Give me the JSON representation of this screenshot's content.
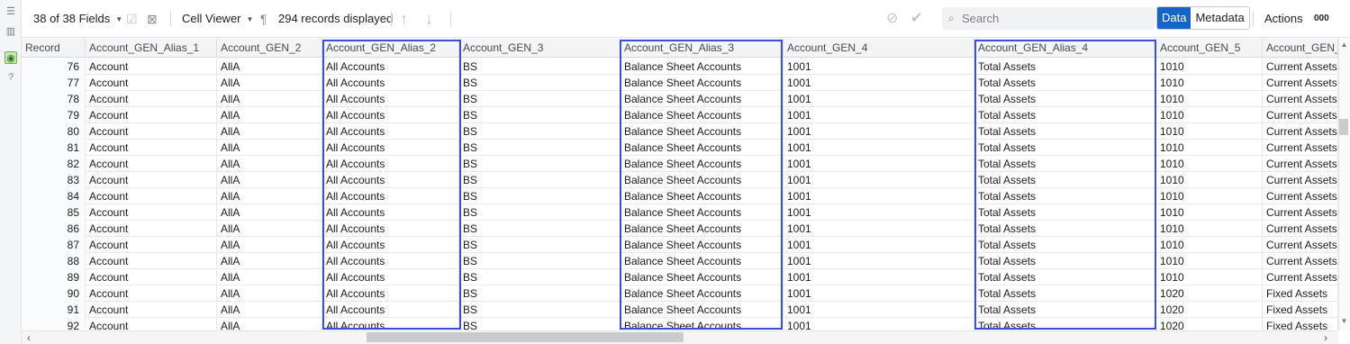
{
  "toolbar": {
    "fields_label": "38 of 38 Fields",
    "cell_viewer_label": "Cell Viewer",
    "pilcrow": "¶",
    "records_label": "294 records displayed",
    "search_placeholder": "Search",
    "data_label": "Data",
    "metadata_label": "Metadata",
    "actions_label": "Actions",
    "more_label": "000"
  },
  "columns": [
    "Record",
    "Account_GEN_Alias_1",
    "Account_GEN_2",
    "Account_GEN_Alias_2",
    "Account_GEN_3",
    "Account_GEN_Alias_3",
    "Account_GEN_4",
    "Account_GEN_Alias_4",
    "Account_GEN_5",
    "Account_GEN_A"
  ],
  "rows": [
    [
      "76",
      "Account",
      "AllA",
      "All Accounts",
      "BS",
      "Balance Sheet Accounts",
      "1001",
      "Total Assets",
      "1010",
      "Current Assets"
    ],
    [
      "77",
      "Account",
      "AllA",
      "All Accounts",
      "BS",
      "Balance Sheet Accounts",
      "1001",
      "Total Assets",
      "1010",
      "Current Assets"
    ],
    [
      "78",
      "Account",
      "AllA",
      "All Accounts",
      "BS",
      "Balance Sheet Accounts",
      "1001",
      "Total Assets",
      "1010",
      "Current Assets"
    ],
    [
      "79",
      "Account",
      "AllA",
      "All Accounts",
      "BS",
      "Balance Sheet Accounts",
      "1001",
      "Total Assets",
      "1010",
      "Current Assets"
    ],
    [
      "80",
      "Account",
      "AllA",
      "All Accounts",
      "BS",
      "Balance Sheet Accounts",
      "1001",
      "Total Assets",
      "1010",
      "Current Assets"
    ],
    [
      "81",
      "Account",
      "AllA",
      "All Accounts",
      "BS",
      "Balance Sheet Accounts",
      "1001",
      "Total Assets",
      "1010",
      "Current Assets"
    ],
    [
      "82",
      "Account",
      "AllA",
      "All Accounts",
      "BS",
      "Balance Sheet Accounts",
      "1001",
      "Total Assets",
      "1010",
      "Current Assets"
    ],
    [
      "83",
      "Account",
      "AllA",
      "All Accounts",
      "BS",
      "Balance Sheet Accounts",
      "1001",
      "Total Assets",
      "1010",
      "Current Assets"
    ],
    [
      "84",
      "Account",
      "AllA",
      "All Accounts",
      "BS",
      "Balance Sheet Accounts",
      "1001",
      "Total Assets",
      "1010",
      "Current Assets"
    ],
    [
      "85",
      "Account",
      "AllA",
      "All Accounts",
      "BS",
      "Balance Sheet Accounts",
      "1001",
      "Total Assets",
      "1010",
      "Current Assets"
    ],
    [
      "86",
      "Account",
      "AllA",
      "All Accounts",
      "BS",
      "Balance Sheet Accounts",
      "1001",
      "Total Assets",
      "1010",
      "Current Assets"
    ],
    [
      "87",
      "Account",
      "AllA",
      "All Accounts",
      "BS",
      "Balance Sheet Accounts",
      "1001",
      "Total Assets",
      "1010",
      "Current Assets"
    ],
    [
      "88",
      "Account",
      "AllA",
      "All Accounts",
      "BS",
      "Balance Sheet Accounts",
      "1001",
      "Total Assets",
      "1010",
      "Current Assets"
    ],
    [
      "89",
      "Account",
      "AllA",
      "All Accounts",
      "BS",
      "Balance Sheet Accounts",
      "1001",
      "Total Assets",
      "1010",
      "Current Assets"
    ],
    [
      "90",
      "Account",
      "AllA",
      "All Accounts",
      "BS",
      "Balance Sheet Accounts",
      "1001",
      "Total Assets",
      "1020",
      "Fixed Assets"
    ],
    [
      "91",
      "Account",
      "AllA",
      "All Accounts",
      "BS",
      "Balance Sheet Accounts",
      "1001",
      "Total Assets",
      "1020",
      "Fixed Assets"
    ],
    [
      "92",
      "Account",
      "AllA",
      "All Accounts",
      "BS",
      "Balance Sheet Accounts",
      "1001",
      "Total Assets",
      "1020",
      "Fixed Assets"
    ]
  ],
  "colors": {
    "accent": "#1565c8",
    "highlight": "#3c4ee0"
  }
}
